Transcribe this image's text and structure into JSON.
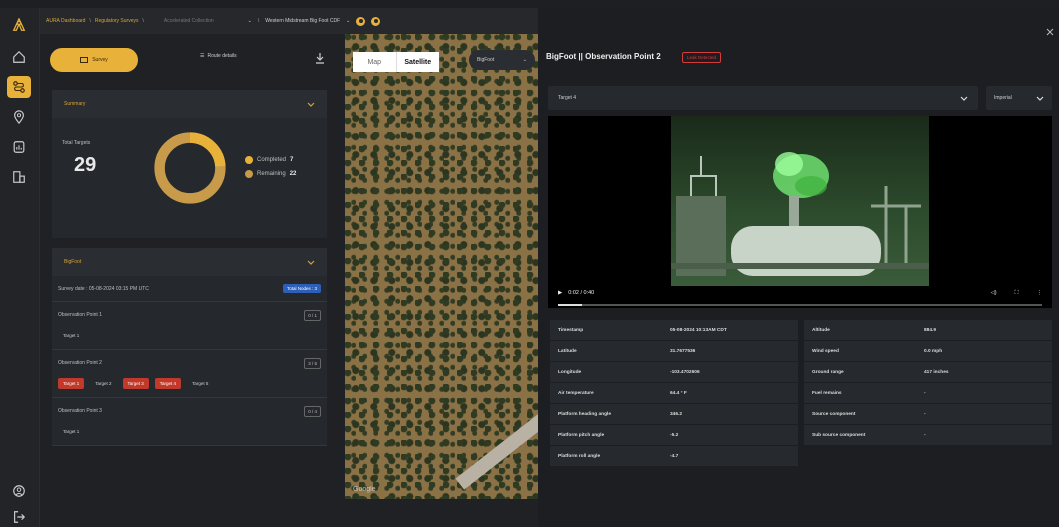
{
  "breadcrumb": {
    "dashboard": "AURA Dashboard",
    "surveys": "Regulatory Surveys",
    "dim": "Accelerated Collection",
    "site": "Western Midstream Big Foot CDF"
  },
  "rail": {
    "icons": [
      "aura-logo-icon",
      "home-icon",
      "route-icon",
      "location-pin-icon",
      "reports-icon",
      "inventory-icon",
      "account-icon",
      "logout-icon"
    ]
  },
  "panel": {
    "tab_survey": "Survey",
    "tab_route": "Route details",
    "summary": {
      "header": "Summary",
      "total_label": "Total Targets",
      "total_value": "29",
      "completed_label": "Completed",
      "completed_value": "7",
      "remaining_label": "Remaining",
      "remaining_value": "22",
      "completed_fraction": 0.24,
      "completed_color": "#e8b13a",
      "remaining_color": "#c79b4a"
    },
    "bigfoot": {
      "header": "BigFoot",
      "survey_date": "Survey date : 05-08-2024 03:15 PM UTC",
      "nodes_badge": "Total Nodes : 3",
      "points": [
        {
          "title": "Observation Point 1",
          "count": "0 / 1",
          "targets": [
            {
              "label": "Target 1",
              "leak": false
            }
          ]
        },
        {
          "title": "Observation Point 2",
          "count": "3 / 5",
          "targets": [
            {
              "label": "Target 1",
              "leak": true
            },
            {
              "label": "Target 2",
              "leak": false
            },
            {
              "label": "Target 3",
              "leak": true
            },
            {
              "label": "Target 4",
              "leak": true
            },
            {
              "label": "Target 5",
              "leak": false
            }
          ]
        },
        {
          "title": "Observation Point 3",
          "count": "0 / 4",
          "targets": [
            {
              "label": "Target 1",
              "leak": false
            }
          ]
        }
      ]
    }
  },
  "map": {
    "map_label": "Map",
    "satellite_label": "Satellite",
    "layer_select": "BigFoot",
    "attribution": "Google"
  },
  "observation": {
    "title": "BigFoot || Observation Point 2",
    "badge": "Leak Detected",
    "target_select": "Target 4",
    "unit_select": "Imperial",
    "video_time": "0:02 / 0:40",
    "video_progress": 0.05,
    "left_table": [
      {
        "k": "Timestamp",
        "v": "05-08-2024 10:13AM CDT"
      },
      {
        "k": "Latitude",
        "v": "31.7677536"
      },
      {
        "k": "Longitude",
        "v": "-103.4702606"
      },
      {
        "k": "Air temperature",
        "v": "64.4 ° F"
      },
      {
        "k": "Platform heading angle",
        "v": "346.2"
      },
      {
        "k": "Platform pitch angle",
        "v": "-5.2"
      },
      {
        "k": "Platform roll angle",
        "v": "-4.7"
      }
    ],
    "right_table": [
      {
        "k": "Altitude",
        "v": "884.9"
      },
      {
        "k": "Wind speed",
        "v": "0.0 mph"
      },
      {
        "k": "Ground range",
        "v": "417 inches"
      },
      {
        "k": "Fuel remains",
        "v": "-"
      },
      {
        "k": "Source component",
        "v": "-"
      },
      {
        "k": "Sub source component",
        "v": "-"
      }
    ]
  }
}
